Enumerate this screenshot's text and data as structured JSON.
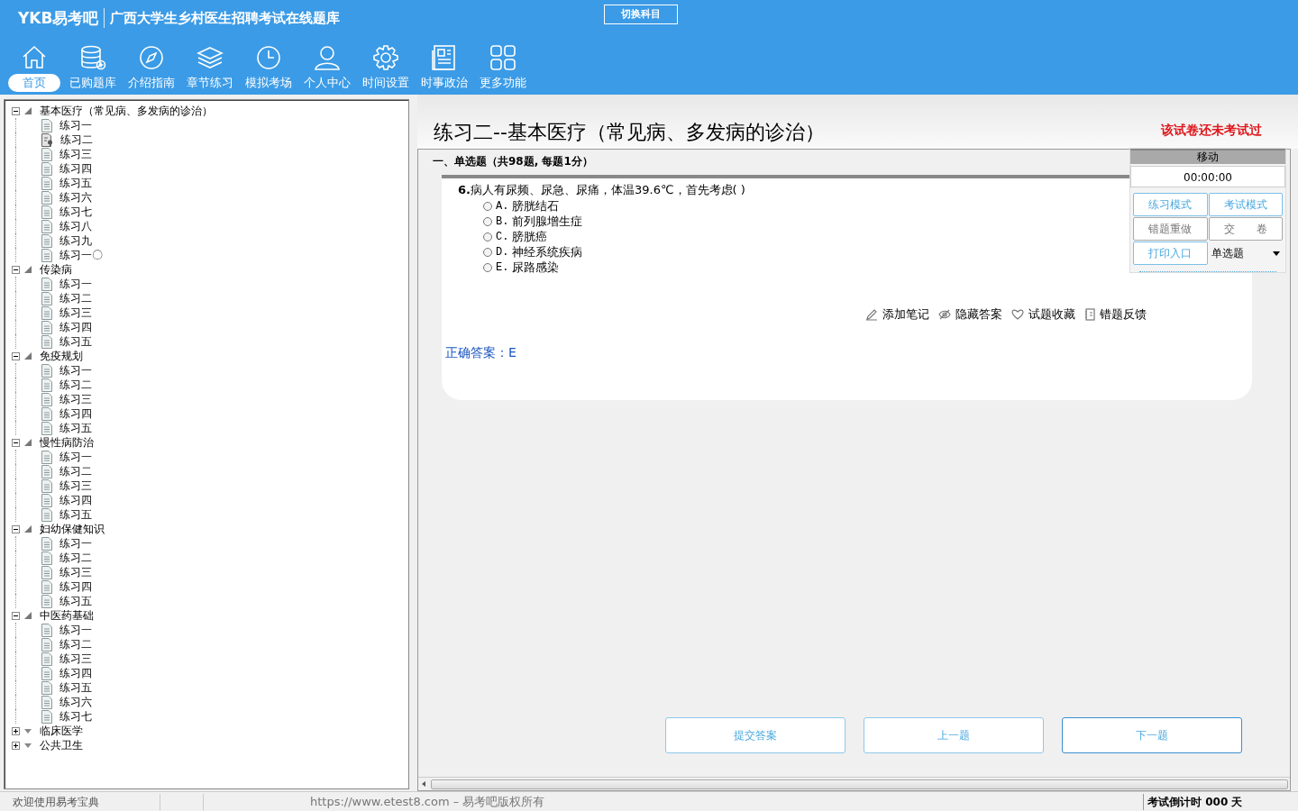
{
  "header": {
    "logo": "YKB易考吧",
    "title": "广西大学生乡村医生招聘考试在线题库",
    "switch_button": "切换科目"
  },
  "nav": [
    {
      "label": "首页",
      "selected": true
    },
    {
      "label": "已购题库",
      "selected": false
    },
    {
      "label": "介绍指南",
      "selected": false
    },
    {
      "label": "章节练习",
      "selected": false
    },
    {
      "label": "模拟考场",
      "selected": false
    },
    {
      "label": "个人中心",
      "selected": false
    },
    {
      "label": "时间设置",
      "selected": false
    },
    {
      "label": "时事政治",
      "selected": false
    },
    {
      "label": "更多功能",
      "selected": false
    }
  ],
  "tree": [
    {
      "label": "基本医疗（常见病、多发病的诊治）",
      "expanded": true,
      "children": [
        {
          "label": "练习一",
          "kind": "doc"
        },
        {
          "label": "练习二",
          "kind": "current"
        },
        {
          "label": "练习三",
          "kind": "doc"
        },
        {
          "label": "练习四",
          "kind": "doc"
        },
        {
          "label": "练习五",
          "kind": "doc"
        },
        {
          "label": "练习六",
          "kind": "doc"
        },
        {
          "label": "练习七",
          "kind": "doc"
        },
        {
          "label": "练习八",
          "kind": "doc"
        },
        {
          "label": "练习九",
          "kind": "doc"
        },
        {
          "label": "练习一〇",
          "kind": "doc"
        }
      ]
    },
    {
      "label": "传染病",
      "expanded": true,
      "children": [
        {
          "label": "练习一",
          "kind": "doc"
        },
        {
          "label": "练习二",
          "kind": "doc"
        },
        {
          "label": "练习三",
          "kind": "doc"
        },
        {
          "label": "练习四",
          "kind": "doc"
        },
        {
          "label": "练习五",
          "kind": "doc"
        }
      ]
    },
    {
      "label": "免疫规划",
      "expanded": true,
      "children": [
        {
          "label": "练习一",
          "kind": "doc"
        },
        {
          "label": "练习二",
          "kind": "doc"
        },
        {
          "label": "练习三",
          "kind": "doc"
        },
        {
          "label": "练习四",
          "kind": "doc"
        },
        {
          "label": "练习五",
          "kind": "doc"
        }
      ]
    },
    {
      "label": "慢性病防治",
      "expanded": true,
      "children": [
        {
          "label": "练习一",
          "kind": "doc"
        },
        {
          "label": "练习二",
          "kind": "doc"
        },
        {
          "label": "练习三",
          "kind": "doc"
        },
        {
          "label": "练习四",
          "kind": "doc"
        },
        {
          "label": "练习五",
          "kind": "doc"
        }
      ]
    },
    {
      "label": "妇幼保健知识",
      "expanded": true,
      "children": [
        {
          "label": "练习一",
          "kind": "doc"
        },
        {
          "label": "练习二",
          "kind": "doc"
        },
        {
          "label": "练习三",
          "kind": "doc"
        },
        {
          "label": "练习四",
          "kind": "doc"
        },
        {
          "label": "练习五",
          "kind": "doc"
        }
      ]
    },
    {
      "label": "中医药基础",
      "expanded": true,
      "children": [
        {
          "label": "练习一",
          "kind": "doc"
        },
        {
          "label": "练习二",
          "kind": "doc"
        },
        {
          "label": "练习三",
          "kind": "doc"
        },
        {
          "label": "练习四",
          "kind": "doc"
        },
        {
          "label": "练习五",
          "kind": "doc"
        },
        {
          "label": "练习六",
          "kind": "doc"
        },
        {
          "label": "练习七",
          "kind": "doc"
        }
      ]
    },
    {
      "label": "临床医学",
      "expanded": false
    },
    {
      "label": "公共卫生",
      "expanded": false
    }
  ],
  "exam": {
    "title": "练习二--基本医疗（常见病、多发病的诊治）",
    "status": "该试卷还未考试过",
    "section": "一、单选题（共98题, 每题1分）",
    "question": {
      "number": "6.",
      "text": "病人有尿频、尿急、尿痛，体温39.6℃，首先考虑( )",
      "options": [
        {
          "letter": "A.",
          "text": "膀胱结石",
          "selected": false
        },
        {
          "letter": "B.",
          "text": "前列腺增生症",
          "selected": false
        },
        {
          "letter": "C.",
          "text": "膀胱癌",
          "selected": false
        },
        {
          "letter": "D.",
          "text": "神经系统疾病",
          "selected": false
        },
        {
          "letter": "E.",
          "text": "尿路感染",
          "selected": false
        }
      ]
    },
    "actions": [
      "添加笔记",
      "隐藏答案",
      "试题收藏",
      "错题反馈"
    ],
    "answer": "正确答案：E",
    "buttons": [
      "提交答案",
      "上一题",
      "下一题"
    ]
  },
  "float_panel": {
    "title": "移动",
    "timer": "00:00:00",
    "buttons": [
      {
        "label": "练习模式",
        "disabled": false
      },
      {
        "label": "考试模式",
        "disabled": false
      },
      {
        "label": "错题重做",
        "disabled": true
      },
      {
        "label": "交　　卷",
        "disabled": true
      },
      {
        "label": "打印入口",
        "disabled": false
      }
    ],
    "select": "单选题"
  },
  "status_bar": {
    "welcome": "欢迎使用易考宝典",
    "copyright": "https://www.etest8.com – 易考吧版权所有",
    "countdown": "考试倒计时 000 天"
  }
}
